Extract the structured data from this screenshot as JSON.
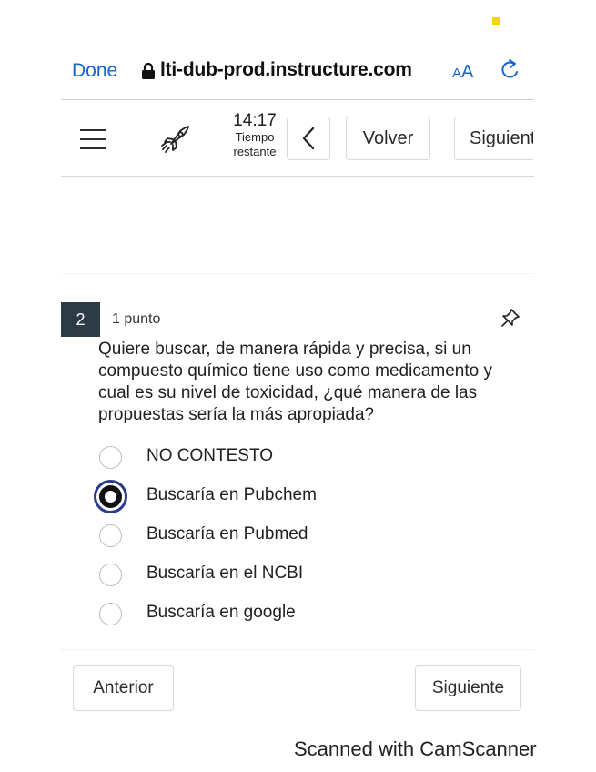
{
  "browser": {
    "done_label": "Done",
    "url": "lti-dub-prod.instructure.com",
    "text_size_label_small": "A",
    "text_size_label_large": "A",
    "lock_icon": "lock-icon",
    "reload_icon": "reload-icon",
    "accent_color": "#1465cc"
  },
  "toolbar": {
    "menu_icon": "hamburger-icon",
    "rocket_icon": "rocket-icon",
    "timer_time": "14:17",
    "timer_label_line1": "Tiempo",
    "timer_label_line2": "restante",
    "back_icon": "chevron-left-icon",
    "volver_label": "Volver",
    "siguiente_label": "Siguiente"
  },
  "question": {
    "number": "2",
    "points": "1 punto",
    "pin_icon": "pin-icon",
    "text": "Quiere buscar, de manera rápida y precisa, si un compuesto químico tiene uso como medicamento y cual es su nivel de toxicidad, ¿qué manera de las propuestas sería la más apropiada?",
    "number_badge_color": "#2d3b45",
    "answers": [
      {
        "label": "NO CONTESTO",
        "selected": false
      },
      {
        "label": "Buscaría en Pubchem",
        "selected": true
      },
      {
        "label": "Buscaría en Pubmed",
        "selected": false
      },
      {
        "label": "Buscaría en el NCBI",
        "selected": false
      },
      {
        "label": "Buscaría en google",
        "selected": false
      }
    ]
  },
  "navigation": {
    "previous_label": "Anterior",
    "next_label": "Siguiente"
  },
  "watermark": "Scanned with CamScanner"
}
